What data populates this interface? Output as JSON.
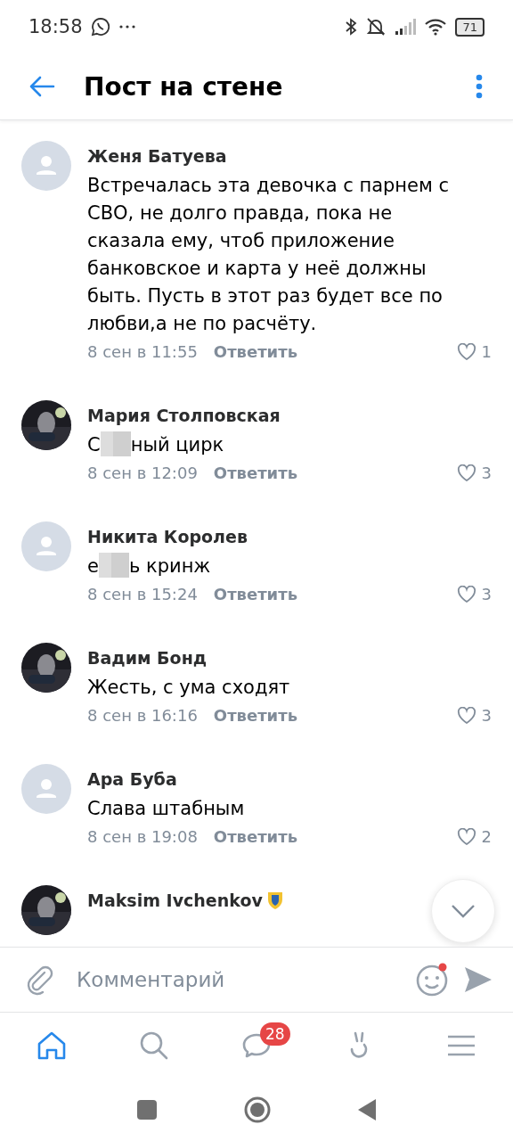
{
  "status_bar": {
    "time": "18:58",
    "battery": "71"
  },
  "header": {
    "title": "Пост на стене"
  },
  "comments": [
    {
      "author": "Женя Батуева",
      "avatar": {
        "kind": "placeholder"
      },
      "parts": [
        {
          "kind": "text",
          "text": "Встречалась эта девочка с парнем с СВО, не долго правда, пока не сказала ему, чтоб приложение банковское и карта у неё должны быть. Пусть в этот раз будет все по любви,а не по расчёту."
        }
      ],
      "date": "8 сен в 11:55",
      "reply": "Ответить",
      "likes": "1"
    },
    {
      "author": "Мария Столповская",
      "parts": [
        {
          "kind": "text",
          "text": "С"
        },
        {
          "kind": "censor"
        },
        {
          "kind": "text",
          "text": "ный цирк"
        }
      ],
      "date": "8 сен в 12:09",
      "reply": "Ответить",
      "likes": "3"
    },
    {
      "author": "Никита Королев",
      "avatar": {
        "kind": "placeholder"
      },
      "parts": [
        {
          "kind": "text",
          "text": "е"
        },
        {
          "kind": "censor"
        },
        {
          "kind": "text",
          "text": "ь кринж"
        }
      ],
      "date": "8 сен в 15:24",
      "reply": "Ответить",
      "likes": "3"
    },
    {
      "author": "Вадим Бонд",
      "parts": [
        {
          "kind": "text",
          "text": "Жесть, с ума сходят"
        }
      ],
      "date": "8 сен в 16:16",
      "reply": "Ответить",
      "likes": "3"
    },
    {
      "author": "Ара Буба",
      "avatar": {
        "kind": "placeholder"
      },
      "parts": [
        {
          "kind": "text",
          "text": "Слава штабным"
        }
      ],
      "date": "8 сен в 19:08",
      "reply": "Ответить",
      "likes": "2"
    },
    {
      "author": "Maksim Ivchenkov",
      "badge": true
    }
  ],
  "composer": {
    "placeholder": "Комментарий",
    "emoji_dot": true
  },
  "nav": [
    {
      "kind": "home",
      "selected": true
    },
    {
      "kind": "search",
      "selected": false
    },
    {
      "kind": "messages",
      "selected": false,
      "badge": "28"
    },
    {
      "kind": "clips",
      "selected": false
    },
    {
      "kind": "menu",
      "selected": false
    }
  ]
}
